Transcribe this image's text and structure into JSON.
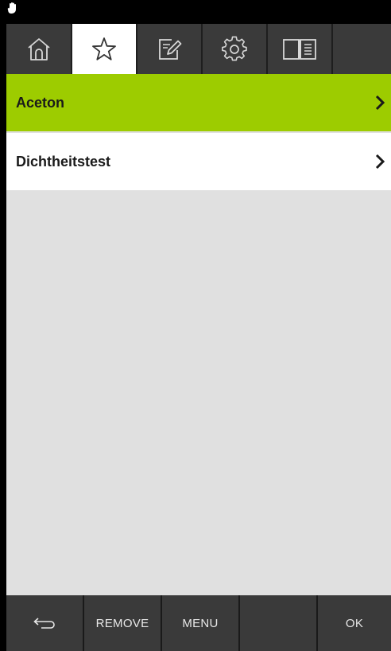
{
  "status_bar": {
    "icon": "hand-icon"
  },
  "tabs": [
    {
      "name": "home",
      "icon": "home-icon",
      "active": false
    },
    {
      "name": "favorites",
      "icon": "star-icon",
      "active": true
    },
    {
      "name": "edit",
      "icon": "edit-icon",
      "active": false
    },
    {
      "name": "settings",
      "icon": "gear-icon",
      "active": false
    },
    {
      "name": "manual",
      "icon": "book-icon",
      "active": false
    }
  ],
  "list": {
    "items": [
      {
        "label": "Aceton",
        "selected": true
      },
      {
        "label": "Dichtheitstest",
        "selected": false
      }
    ]
  },
  "softkeys": {
    "back_icon": "back-arrow-icon",
    "remove": "REMOVE",
    "menu": "MENU",
    "empty": "",
    "ok": "OK"
  },
  "colors": {
    "accent_green": "#9dcc00",
    "key_bg": "#3a3a3a",
    "list_bg": "#e0e0e0"
  }
}
